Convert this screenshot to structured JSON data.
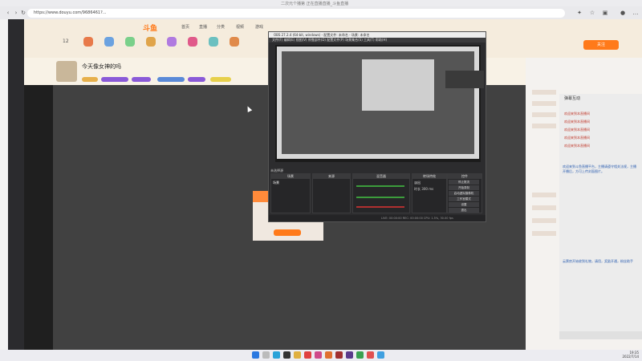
{
  "browser": {
    "window_title": "二次元个播第 正在直播直播_斗鱼直播",
    "url": "https://www.douyu.com/9686461?...",
    "nav_icons": [
      "back-icon",
      "forward-icon",
      "refresh-icon"
    ]
  },
  "site": {
    "logo": "斗鱼",
    "nav": [
      "首页",
      "直播",
      "分类",
      "视频",
      "游戏"
    ],
    "follow_count": "12",
    "room_title": "今天像女神的吗",
    "subscribe_label": "关注"
  },
  "obs": {
    "title": "OBS 27.2.4 (64-bit, windows) - 配置文件: 未命名 - 场景: 未命名",
    "menu": [
      "文件(F)",
      "编辑(E)",
      "视图(V)",
      "停靠部件(D)",
      "配置文件(P)",
      "场景集合(S)",
      "工具(T)",
      "帮助(H)"
    ],
    "source_label": "未选择源",
    "docks": {
      "scenes": "场景",
      "sources": "来源",
      "mixer": "混音器",
      "transitions": "转场特效",
      "controls": "控件"
    },
    "scene_item": "场景",
    "controls": [
      "停止推流",
      "开始录制",
      "启动虚拟摄像机",
      "工作室模式",
      "设置",
      "退出"
    ],
    "transition_name": "淡出",
    "duration_label": "时长",
    "duration_value": "300 ms",
    "status": "LIVE: 00:00:00  REC: 00:00:00  CPU: 1.5%, 30.00 fps"
  },
  "chat": {
    "title": "弹幕互动",
    "messages": [
      "欢迎来到本直播间",
      "欢迎来到本直播间",
      "欢迎来到本直播间",
      "欢迎来到本直播间",
      "欢迎来到本直播间"
    ],
    "notice": "欢迎来到斗鱼直播平台，主播请遵守相关法规，主播开播后，方可上传封面图片。",
    "notice2": "云票房开始收到礼物，请用，奖励开通，粉丝助手"
  },
  "taskbar": {
    "time": "19:35",
    "date": "2022/7/14"
  },
  "colors": {
    "accent": "#ff7a1a",
    "obs_bg": "#2c2c2e",
    "stage": "#414141"
  }
}
